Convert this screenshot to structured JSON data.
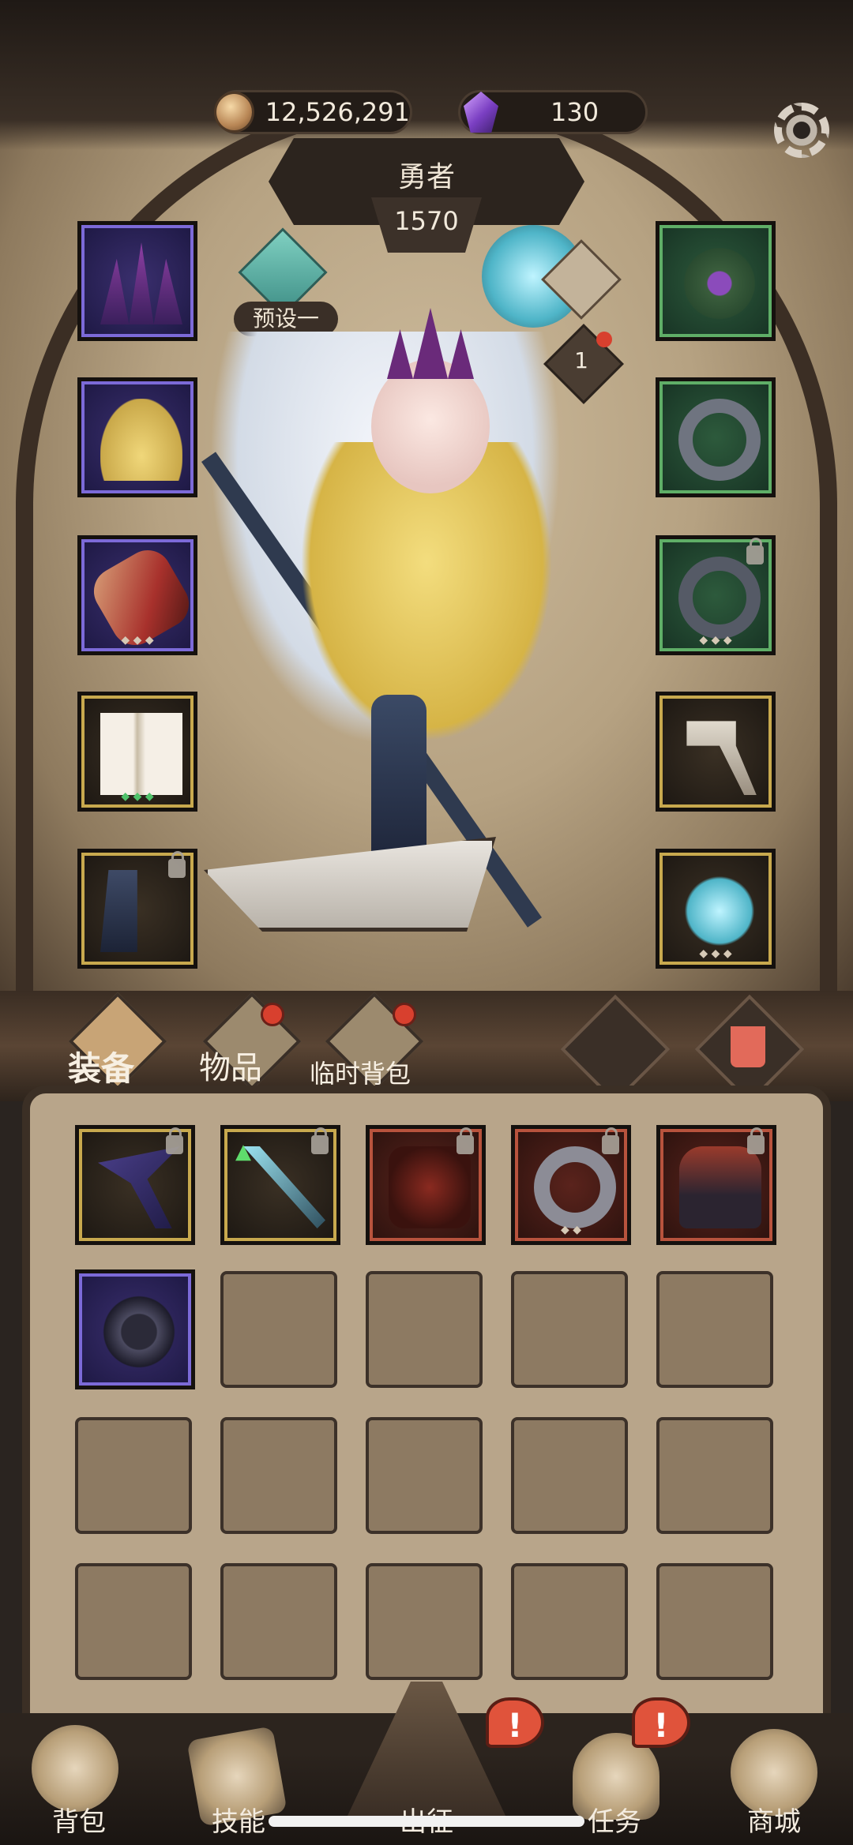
{
  "currency": {
    "gold": "12,526,291",
    "gems": "130"
  },
  "hero": {
    "title": "勇者",
    "power": "1570",
    "preset_label": "预设一",
    "badge_count": "1"
  },
  "equipment": {
    "left": [
      {
        "name": "crown",
        "rarity": "purple",
        "locked": false
      },
      {
        "name": "dress",
        "rarity": "purple",
        "locked": false
      },
      {
        "name": "gauntlet",
        "rarity": "purple",
        "locked": false
      },
      {
        "name": "stockings",
        "rarity": "gold",
        "locked": false
      },
      {
        "name": "boots",
        "rarity": "gold",
        "locked": true
      }
    ],
    "right": [
      {
        "name": "necklace",
        "rarity": "green",
        "locked": false
      },
      {
        "name": "ring",
        "rarity": "green",
        "locked": false
      },
      {
        "name": "ring",
        "rarity": "green",
        "locked": true
      },
      {
        "name": "hammer",
        "rarity": "gold",
        "locked": false
      },
      {
        "name": "relic",
        "rarity": "gold",
        "locked": false
      }
    ]
  },
  "tabs": [
    {
      "label": "装备",
      "active": true,
      "dot": false
    },
    {
      "label": "物品",
      "active": false,
      "dot": true
    },
    {
      "label": "临时背包",
      "active": false,
      "dot": true
    }
  ],
  "inventory": {
    "items": [
      {
        "name": "scythe",
        "rarity": "gold",
        "locked": true
      },
      {
        "name": "spear",
        "rarity": "gold",
        "locked": true
      },
      {
        "name": "chest-emblem",
        "rarity": "red",
        "locked": true
      },
      {
        "name": "ring",
        "rarity": "red",
        "locked": true
      },
      {
        "name": "armor",
        "rarity": "red",
        "locked": true
      },
      {
        "name": "amulet",
        "rarity": "purple",
        "locked": false
      }
    ]
  },
  "nav": [
    {
      "label": "背包",
      "icon": "backpack-icon",
      "alert": false
    },
    {
      "label": "技能",
      "icon": "skill-book-icon",
      "alert": false
    },
    {
      "label": "出征",
      "icon": "sword-icon",
      "alert": true
    },
    {
      "label": "任务",
      "icon": "horn-icon",
      "alert": true
    },
    {
      "label": "商城",
      "icon": "shop-icon",
      "alert": false
    }
  ],
  "colors": {
    "accent_red": "#d8402e",
    "panel": "#b8a58a",
    "frame": "#3b2e24"
  }
}
